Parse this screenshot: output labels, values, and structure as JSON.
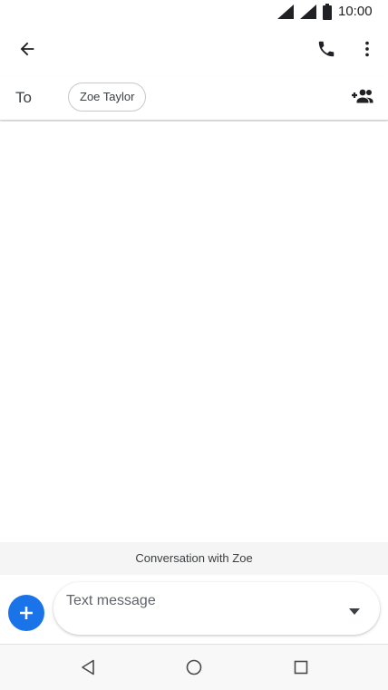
{
  "status_bar": {
    "time": "10:00",
    "icons": [
      "cell-signal-icon",
      "wifi-signal-icon",
      "battery-icon"
    ]
  },
  "app_bar": {
    "icons": [
      "back-arrow-icon",
      "phone-icon",
      "more-vert-icon"
    ]
  },
  "recipient_row": {
    "to_label": "To",
    "chips": [
      "Zoe Taylor"
    ],
    "add_icon": "add-people-icon"
  },
  "conversation": {
    "banner": "Conversation with Zoe"
  },
  "compose": {
    "placeholder": "Text message",
    "value": "",
    "fab_icon": "plus-icon",
    "dropdown_icon": "arrow-drop-down-icon"
  },
  "nav_bar": {
    "icons": [
      "nav-back-icon",
      "nav-home-icon",
      "nav-recents-icon"
    ]
  },
  "colors": {
    "accent": "#1a73e8",
    "banner_bg": "#f5f5f5",
    "text_primary": "#202124",
    "text_secondary": "#5f6368"
  }
}
